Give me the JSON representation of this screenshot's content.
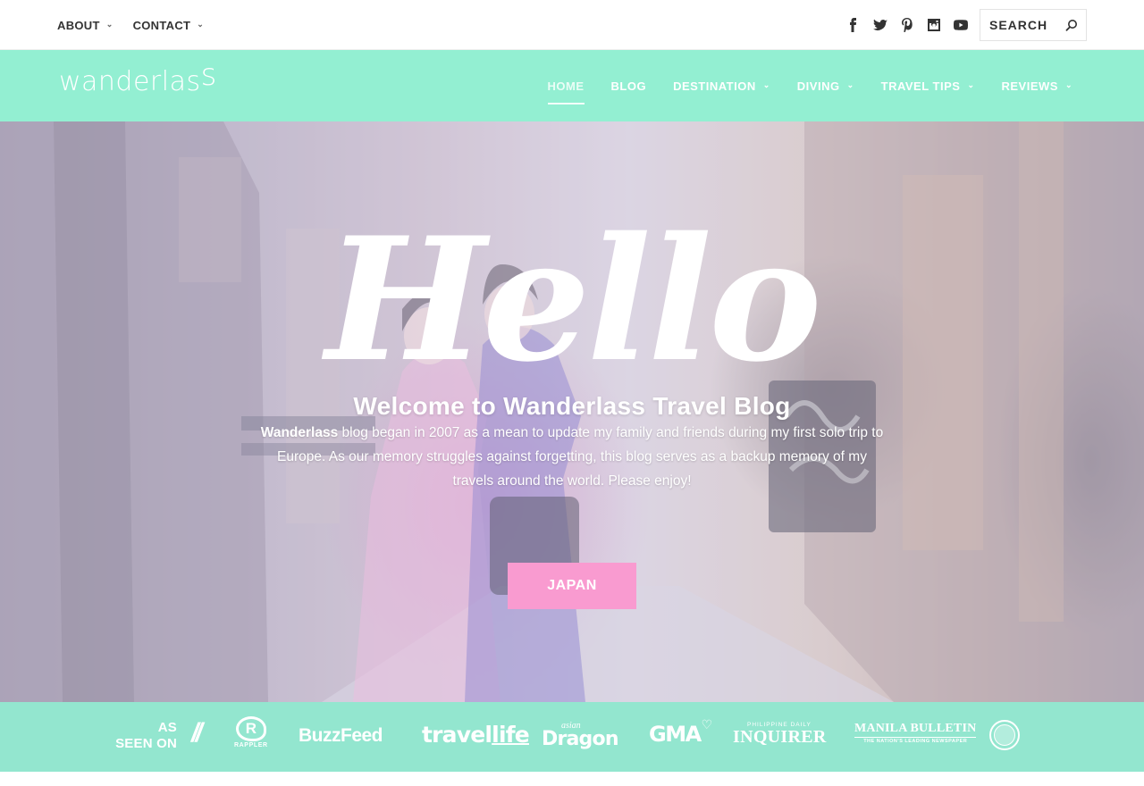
{
  "topbar": {
    "links": [
      {
        "label": "ABOUT"
      },
      {
        "label": "CONTACT"
      }
    ],
    "social_icons": [
      "facebook-icon",
      "twitter-icon",
      "pinterest-icon",
      "instagram-icon",
      "youtube-icon"
    ],
    "search": {
      "placeholder": "SEARCH",
      "value": ""
    }
  },
  "header": {
    "logo_main": "wanderlas",
    "logo_tail": "s",
    "nav": [
      {
        "label": "HOME",
        "active": true
      },
      {
        "label": "BLOG"
      },
      {
        "label": "DESTINATION"
      },
      {
        "label": "DIVING"
      },
      {
        "label": "TRAVEL TIPS"
      },
      {
        "label": "REVIEWS"
      }
    ]
  },
  "hero": {
    "script_word": "Hello",
    "heading": "Welcome to Wanderlass Travel Blog",
    "intro_bold": "Wanderlass",
    "intro_rest": " blog began in 2007 as a mean to update my family and friends during my first solo trip to Europe. As our memory struggles against forgetting, this blog serves as a backup memory of my travels around the world. Please enjoy!",
    "cta_label": "JAPAN"
  },
  "as_seen_on": {
    "label_line1": "AS",
    "label_line2": "SEEN ON",
    "separator": "//",
    "outlets": {
      "rappler_mark": "R",
      "rappler_name": "RAPPLER",
      "buzzfeed": "BuzzFeed",
      "travelife_main": "travel",
      "travelife_tail": "life",
      "asian_dragon_small": "asian",
      "asian_dragon_main": "Dragon",
      "gma": "GMA",
      "inquirer_small": "PHILIPPINE DAILY",
      "inquirer_main": "INQUIRER",
      "manila_bulletin_main": "MANILA BULLETIN",
      "manila_bulletin_sub": "THE NATION'S LEADING NEWSPAPER"
    }
  },
  "colors": {
    "brand_mint": "#93efd2",
    "accent_pink": "#f99bd0",
    "text_dark": "#333333"
  }
}
